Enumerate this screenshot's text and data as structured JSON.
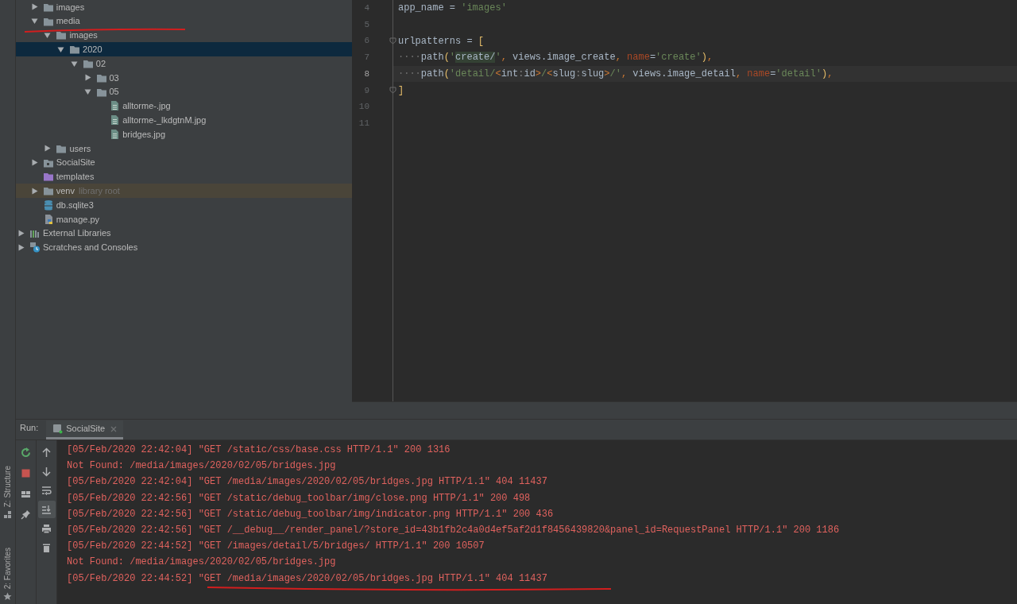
{
  "project_tree": {
    "project_items": [
      {
        "label": "images",
        "kind": "folder",
        "expanded": false,
        "selected": false
      },
      {
        "label": "media",
        "kind": "folder",
        "expanded": true,
        "selected": false,
        "children": [
          {
            "label": "images",
            "kind": "folder",
            "expanded": true,
            "selected": false,
            "children": [
              {
                "label": "2020",
                "kind": "folder",
                "expanded": true,
                "selected": true,
                "children": [
                  {
                    "label": "02",
                    "kind": "folder",
                    "expanded": true,
                    "selected": false,
                    "children": [
                      {
                        "label": "03",
                        "kind": "folder",
                        "expanded": false,
                        "selected": false
                      },
                      {
                        "label": "05",
                        "kind": "folder",
                        "expanded": true,
                        "selected": false,
                        "children": [
                          {
                            "label": "alltorme-.jpg",
                            "kind": "image-file",
                            "selected": false
                          },
                          {
                            "label": "alltorme-_lkdgtnM.jpg",
                            "kind": "image-file",
                            "selected": false
                          },
                          {
                            "label": "bridges.jpg",
                            "kind": "image-file",
                            "selected": false
                          }
                        ]
                      }
                    ]
                  }
                ]
              }
            ]
          },
          {
            "label": "users",
            "kind": "folder",
            "expanded": false,
            "selected": false
          }
        ]
      },
      {
        "label": "SocialSite",
        "kind": "package",
        "expanded": false,
        "selected": false
      },
      {
        "label": "templates",
        "kind": "template-folder",
        "selected": false
      },
      {
        "label": "venv",
        "kind": "folder",
        "expanded": false,
        "selected": false,
        "hint": "library root"
      },
      {
        "label": "db.sqlite3",
        "kind": "database",
        "selected": false
      },
      {
        "label": "manage.py",
        "kind": "python",
        "selected": false
      }
    ],
    "items": [
      {
        "label": "External Libraries",
        "kind": "libraries",
        "expanded": false,
        "selected": false
      },
      {
        "label": "Scratches and Consoles",
        "kind": "scratches",
        "expanded": false,
        "selected": false
      }
    ]
  },
  "editor": {
    "lines": [
      {
        "number": "4",
        "current": false,
        "tokens": [
          {
            "kind": "plain",
            "text": "app_name = "
          },
          {
            "kind": "string",
            "text": "'images'"
          }
        ]
      },
      {
        "number": "5",
        "current": false
      },
      {
        "number": "6",
        "current": false,
        "fold": true,
        "tokens": [
          {
            "kind": "plain",
            "text": "urlpatterns = "
          },
          {
            "kind": "bracket",
            "text": "["
          }
        ]
      },
      {
        "number": "7",
        "current": false,
        "tokens": [
          {
            "kind": "whitespace",
            "text": "····"
          },
          {
            "kind": "plain",
            "text": "path"
          },
          {
            "kind": "bracket",
            "text": "("
          },
          {
            "kind": "string",
            "text": "'"
          },
          {
            "kind": "match",
            "text": "create/"
          },
          {
            "kind": "string",
            "text": "'"
          },
          {
            "kind": "comma",
            "text": ","
          },
          {
            "kind": "plain",
            "text": " views.image_create"
          },
          {
            "kind": "comma",
            "text": ","
          },
          {
            "kind": "param",
            "text": " name"
          },
          {
            "kind": "plain",
            "text": "="
          },
          {
            "kind": "string",
            "text": "'create'"
          },
          {
            "kind": "bracket",
            "text": ")"
          },
          {
            "kind": "comma",
            "text": ","
          }
        ]
      },
      {
        "number": "8",
        "current": true,
        "tokens": [
          {
            "kind": "whitespace",
            "text": "····"
          },
          {
            "kind": "plain",
            "text": "path"
          },
          {
            "kind": "bracket",
            "text": "("
          },
          {
            "kind": "string",
            "text": "'detail/"
          },
          {
            "kind": "angle",
            "text": "<"
          },
          {
            "kind": "plain",
            "text": "int"
          },
          {
            "kind": "sep",
            "text": ":"
          },
          {
            "kind": "plain",
            "text": "id"
          },
          {
            "kind": "angle",
            "text": ">"
          },
          {
            "kind": "string",
            "text": "/"
          },
          {
            "kind": "angle",
            "text": "<"
          },
          {
            "kind": "plain",
            "text": "slug"
          },
          {
            "kind": "sep",
            "text": ":"
          },
          {
            "kind": "plain",
            "text": "slug"
          },
          {
            "kind": "angle",
            "text": ">"
          },
          {
            "kind": "string",
            "text": "/'"
          },
          {
            "kind": "comma",
            "text": ","
          },
          {
            "kind": "plain",
            "text": " views.image_detail"
          },
          {
            "kind": "comma",
            "text": ","
          },
          {
            "kind": "param",
            "text": " name"
          },
          {
            "kind": "plain",
            "text": "="
          },
          {
            "kind": "string",
            "text": "'detail'"
          },
          {
            "kind": "bracket",
            "text": ")"
          },
          {
            "kind": "comma",
            "text": ","
          }
        ]
      },
      {
        "number": "9",
        "current": false,
        "fold": true,
        "tokens": [
          {
            "kind": "bracket",
            "text": "]"
          }
        ]
      },
      {
        "number": "10",
        "current": false
      },
      {
        "number": "11",
        "current": false
      }
    ]
  },
  "side_labels": [
    {
      "label": "Z: Structure",
      "kind": "structure"
    },
    {
      "label": "2: Favorites",
      "kind": "favorites"
    }
  ],
  "run_panel": {
    "title": "Run:",
    "tabs": [
      {
        "label": "SocialSite",
        "selected": true
      }
    ],
    "toolbar": [
      {
        "kind": "rerun"
      },
      {
        "kind": "stop"
      },
      {
        "kind": "layout"
      },
      {
        "kind": "pin"
      }
    ],
    "console_toolbar": [
      {
        "kind": "up",
        "selected": false
      },
      {
        "kind": "down",
        "selected": false
      },
      {
        "kind": "wrap",
        "selected": false
      },
      {
        "kind": "scroll-end",
        "selected": true
      },
      {
        "kind": "print",
        "selected": false
      },
      {
        "kind": "trash",
        "selected": false
      }
    ],
    "log": [
      "[05/Feb/2020 22:42:04] \"GET /static/css/base.css HTTP/1.1\" 200 1316",
      "Not Found: /media/images/2020/02/05/bridges.jpg",
      "[05/Feb/2020 22:42:04] \"GET /media/images/2020/02/05/bridges.jpg HTTP/1.1\" 404 11437",
      "[05/Feb/2020 22:42:56] \"GET /static/debug_toolbar/img/close.png HTTP/1.1\" 200 498",
      "[05/Feb/2020 22:42:56] \"GET /static/debug_toolbar/img/indicator.png HTTP/1.1\" 200 436",
      "[05/Feb/2020 22:42:56] \"GET /__debug__/render_panel/?store_id=43b1fb2c4a0d4ef5af2d1f8456439820&panel_id=RequestPanel HTTP/1.1\" 200 1186",
      "[05/Feb/2020 22:44:52] \"GET /images/detail/5/bridges/ HTTP/1.1\" 200 10507",
      "Not Found: /media/images/2020/02/05/bridges.jpg",
      "[05/Feb/2020 22:44:52] \"GET /media/images/2020/02/05/bridges.jpg HTTP/1.1\" 404 11437"
    ]
  }
}
